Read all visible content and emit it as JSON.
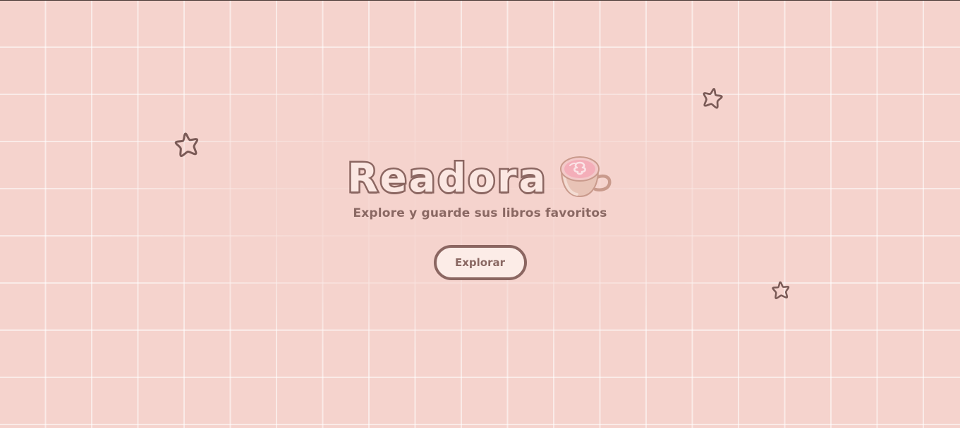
{
  "hero": {
    "title": "Readora",
    "subtitle": "Explore y guarde sus libros favoritos",
    "explore_button_label": "Explorar"
  },
  "decorations": {
    "title_icon": "coffee-cup-icon",
    "star_icon": "star-outline-icon"
  },
  "colors": {
    "background": "#f5d3cd",
    "grid_line": "#ffffff",
    "title_fill": "#fbe7e2",
    "outline_brown": "#8b6661",
    "text_brown": "#8a6863",
    "button_fill": "#fcece7",
    "latte_pink": "#f4aeb9"
  }
}
